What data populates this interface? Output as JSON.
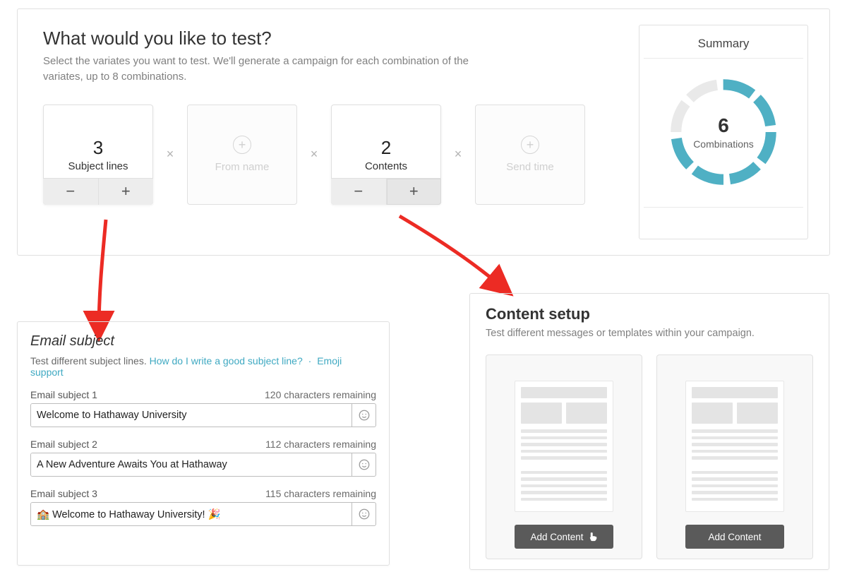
{
  "top": {
    "title": "What would you like to test?",
    "description": "Select the variates you want to test. We'll generate a campaign for each combination of the variates, up to 8 combinations."
  },
  "variates": {
    "subject": {
      "count": "3",
      "label": "Subject lines"
    },
    "from": {
      "label": "From name"
    },
    "contents": {
      "count": "2",
      "label": "Contents"
    },
    "sendtime": {
      "label": "Send time"
    },
    "times_symbol": "×",
    "minus": "−",
    "plus": "+"
  },
  "summary": {
    "title": "Summary",
    "combinations_count": "6",
    "combinations_label": "Combinations",
    "segments": 8,
    "segments_active": [
      0,
      1,
      2,
      3,
      4,
      5
    ]
  },
  "subject_panel": {
    "title": "Email subject",
    "desc_prefix": "Test different subject lines. ",
    "link_howto": "How do I write a good subject line?",
    "separator": "·",
    "link_emoji": "Emoji support",
    "items": [
      {
        "label": "Email subject 1",
        "remaining": "120 characters remaining",
        "value": "Welcome to Hathaway University"
      },
      {
        "label": "Email subject 2",
        "remaining": "112 characters remaining",
        "value": "A New Adventure Awaits You at Hathaway"
      },
      {
        "label": "Email subject 3",
        "remaining": "115 characters remaining",
        "value": "🏫 Welcome to Hathaway University! 🎉"
      }
    ]
  },
  "content_panel": {
    "title": "Content setup",
    "description": "Test different messages or templates within your campaign.",
    "add_button_label": "Add Content"
  },
  "colors": {
    "ring": "#4fb0c4",
    "ring_bg": "#e9e9e9",
    "arrow": "#ec2b24"
  }
}
